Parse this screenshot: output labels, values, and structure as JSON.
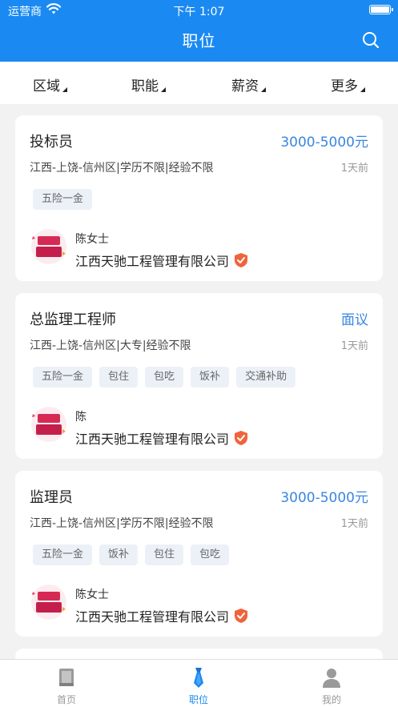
{
  "status_bar": {
    "carrier": "运营商",
    "time": "下午 1:07"
  },
  "header": {
    "title": "职位"
  },
  "filters": [
    "区域",
    "职能",
    "薪资",
    "更多"
  ],
  "jobs": [
    {
      "title": "投标员",
      "salary": "3000-5000元",
      "meta": "江西-上饶-信州区|学历不限|经验不限",
      "posted": "1天前",
      "tags": [
        "五险一金"
      ],
      "contact": "陈女士",
      "company": "江西天驰工程管理有限公司"
    },
    {
      "title": "总监理工程师",
      "salary": "面议",
      "meta": "江西-上饶-信州区|大专|经验不限",
      "posted": "1天前",
      "tags": [
        "五险一金",
        "包住",
        "包吃",
        "饭补",
        "交通补助"
      ],
      "contact": "陈",
      "company": "江西天驰工程管理有限公司"
    },
    {
      "title": "监理员",
      "salary": "3000-5000元",
      "meta": "江西-上饶-信州区|学历不限|经验不限",
      "posted": "1天前",
      "tags": [
        "五险一金",
        "饭补",
        "包住",
        "包吃"
      ],
      "contact": "陈女士",
      "company": "江西天驰工程管理有限公司"
    }
  ],
  "tabbar": {
    "items": [
      "首页",
      "职位",
      "我的"
    ],
    "active": "职位"
  },
  "colors": {
    "primary": "#1a8af2",
    "salary": "#3a86e0",
    "tag_bg": "#ecf1f8",
    "verify": "#f0643c"
  }
}
